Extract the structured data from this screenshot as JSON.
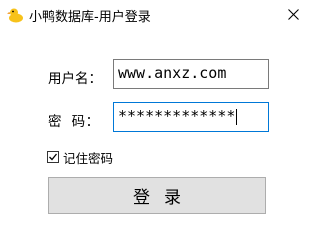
{
  "window": {
    "title": "小鸭数据库-用户登录",
    "icon": "duck-icon",
    "close_glyph": "✕"
  },
  "form": {
    "username_label": "用户名：",
    "username_value": "www.anxz.com",
    "password_label": "密  码：",
    "password_value": "*************",
    "remember_label": "记住密码",
    "remember_checked": true,
    "login_label": "登录"
  },
  "colors": {
    "background": "#ffffff",
    "focus_border": "#0078d7",
    "button_bg": "#e1e1e1",
    "duck_yellow": "#f7c21a"
  }
}
